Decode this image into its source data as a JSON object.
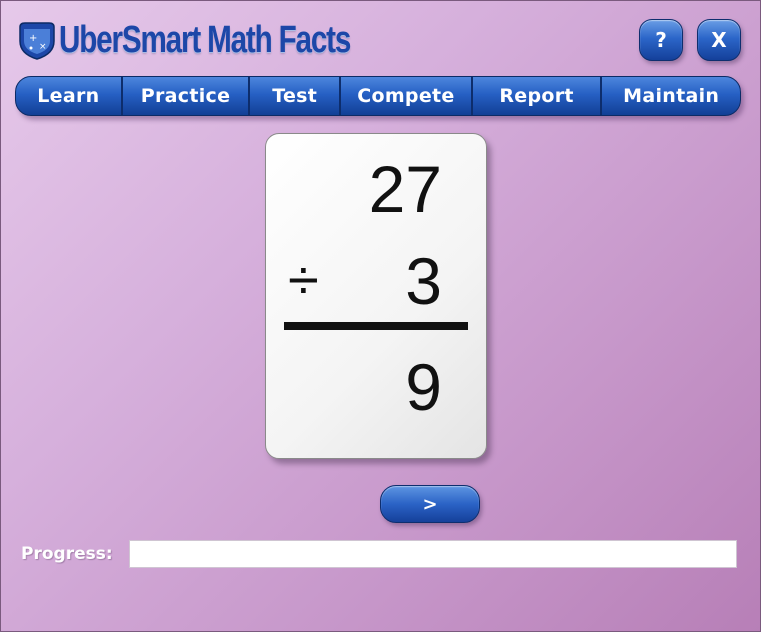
{
  "app": {
    "title": "UberSmart Math Facts",
    "logo_icon": "math-shield-icon"
  },
  "header": {
    "help_label": "?",
    "close_label": "X"
  },
  "nav": {
    "items": [
      {
        "label": "Learn"
      },
      {
        "label": "Practice"
      },
      {
        "label": "Test"
      },
      {
        "label": "Compete"
      },
      {
        "label": "Report"
      },
      {
        "label": "Maintain"
      }
    ]
  },
  "flashcard": {
    "top_number": "27",
    "operator": "÷",
    "bottom_number": "3",
    "answer": "9"
  },
  "controls": {
    "next_label": ">"
  },
  "progress": {
    "label": "Progress:",
    "value": 0
  },
  "colors": {
    "background": "#d6b0dc",
    "button_blue": "#2660c4",
    "logo_blue": "#1d47a8"
  }
}
